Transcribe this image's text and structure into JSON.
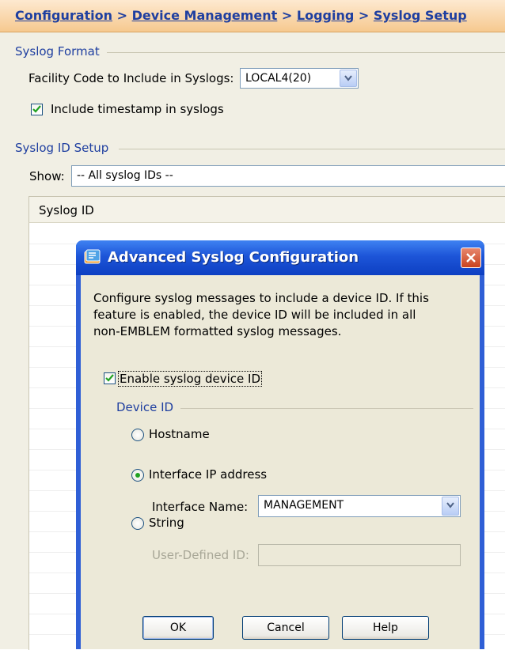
{
  "breadcrumb": {
    "items": [
      "Configuration",
      "Device Management",
      "Logging",
      "Syslog Setup"
    ],
    "separator": ">"
  },
  "syslog_format": {
    "title": "Syslog Format",
    "facility_label": "Facility Code to Include in Syslogs:",
    "facility_value": "LOCAL4(20)",
    "timestamp_checked": true,
    "timestamp_label": "Include timestamp in syslogs"
  },
  "syslog_id_setup": {
    "title": "Syslog ID Setup",
    "show_label": "Show:",
    "show_value": "-- All syslog IDs --",
    "table_column": "Syslog ID"
  },
  "dialog": {
    "title": "Advanced Syslog Configuration",
    "description": [
      "Configure syslog messages to include a device ID. If this",
      "feature is enabled, the device ID will be included in all",
      "non-EMBLEM formatted syslog messages."
    ],
    "enable_checked": true,
    "enable_label": "Enable syslog device ID",
    "device_id_group": "Device ID",
    "hostname_label": "Hostname",
    "interface_ip_label": "Interface IP address",
    "interface_name_label": "Interface Name:",
    "interface_name_value": "MANAGEMENT",
    "string_label": "String",
    "user_defined_label": "User-Defined ID:",
    "user_defined_value": "",
    "selected_option": "interface_ip",
    "buttons": {
      "ok": "OK",
      "cancel": "Cancel",
      "help": "Help"
    }
  },
  "colors": {
    "title_blue": "#1f3fa0",
    "dialog_titlebar": "#1d55d8",
    "header_orange": "#f6c98f",
    "radio_green": "#21a121"
  }
}
